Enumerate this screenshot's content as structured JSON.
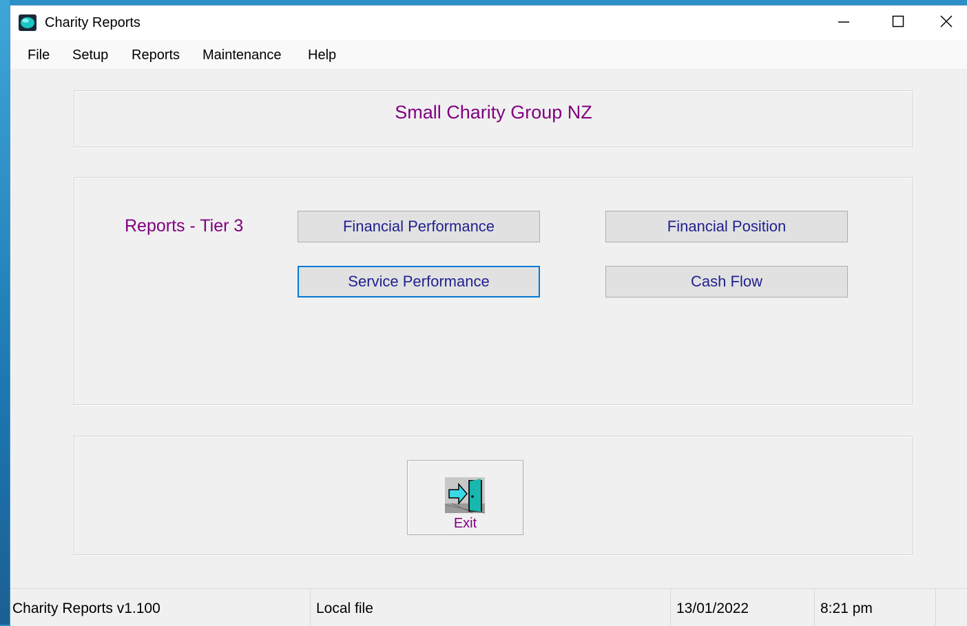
{
  "window": {
    "title": "Charity Reports"
  },
  "menu": {
    "items": [
      "File",
      "Setup",
      "Reports",
      "Maintenance",
      "Help"
    ]
  },
  "header": {
    "org_name": "Small Charity Group NZ"
  },
  "reports": {
    "label": "Reports - Tier 3",
    "buttons": {
      "financial_performance": "Financial Performance",
      "financial_position": "Financial Position",
      "service_performance": "Service Performance",
      "cash_flow": "Cash Flow"
    },
    "focused_button": "service_performance"
  },
  "exit": {
    "label": "Exit"
  },
  "statusbar": {
    "version": "Charity Reports v1.100",
    "source": "Local file",
    "date": "13/01/2022",
    "time": "8:21 pm"
  },
  "colors": {
    "accent_text": "#800080",
    "button_text": "#1f1f8f",
    "focus_border": "#0078d7"
  },
  "icons": {
    "app": "charity-app-icon",
    "minimize": "minimize-icon",
    "maximize": "maximize-icon",
    "close": "close-icon",
    "exit": "exit-door-icon"
  }
}
